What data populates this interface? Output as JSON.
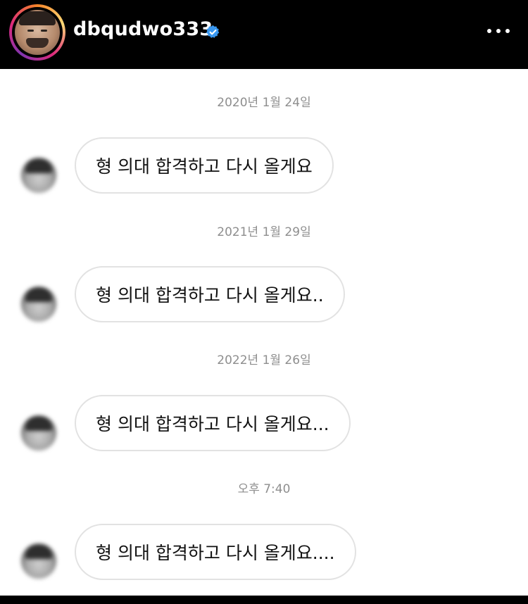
{
  "header": {
    "username": "dbqudwo333",
    "verified_icon": "verified-badge-icon",
    "more_icon": "more-options-icon",
    "accent": "#3897f0"
  },
  "thread": [
    {
      "timestamp": "2020년 1월 24일",
      "message": "형 의대 합격하고 다시 올게요"
    },
    {
      "timestamp": "2021년 1월 29일",
      "message": "형 의대 합격하고 다시 올게요.."
    },
    {
      "timestamp": "2022년 1월 26일",
      "message": "형 의대 합격하고 다시 올게요..."
    },
    {
      "timestamp": "오후 7:40",
      "message": "형 의대 합격하고 다시 올게요...."
    }
  ]
}
